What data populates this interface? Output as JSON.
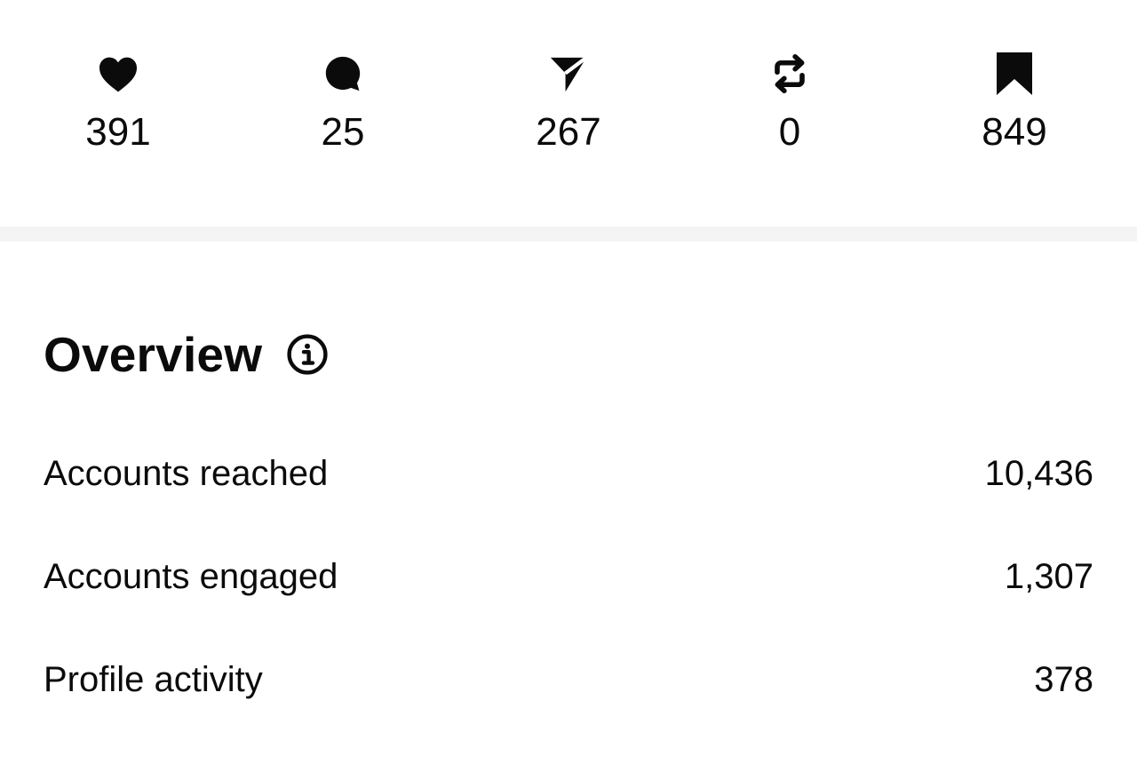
{
  "stats": [
    {
      "icon": "heart-icon",
      "count": "391"
    },
    {
      "icon": "comment-icon",
      "count": "25"
    },
    {
      "icon": "share-icon",
      "count": "267"
    },
    {
      "icon": "repost-icon",
      "count": "0"
    },
    {
      "icon": "bookmark-icon",
      "count": "849"
    }
  ],
  "overview": {
    "title": "Overview",
    "info_icon": "info-icon",
    "metrics": [
      {
        "label": "Accounts reached",
        "value": "10,436"
      },
      {
        "label": "Accounts engaged",
        "value": "1,307"
      },
      {
        "label": "Profile activity",
        "value": "378"
      }
    ]
  }
}
